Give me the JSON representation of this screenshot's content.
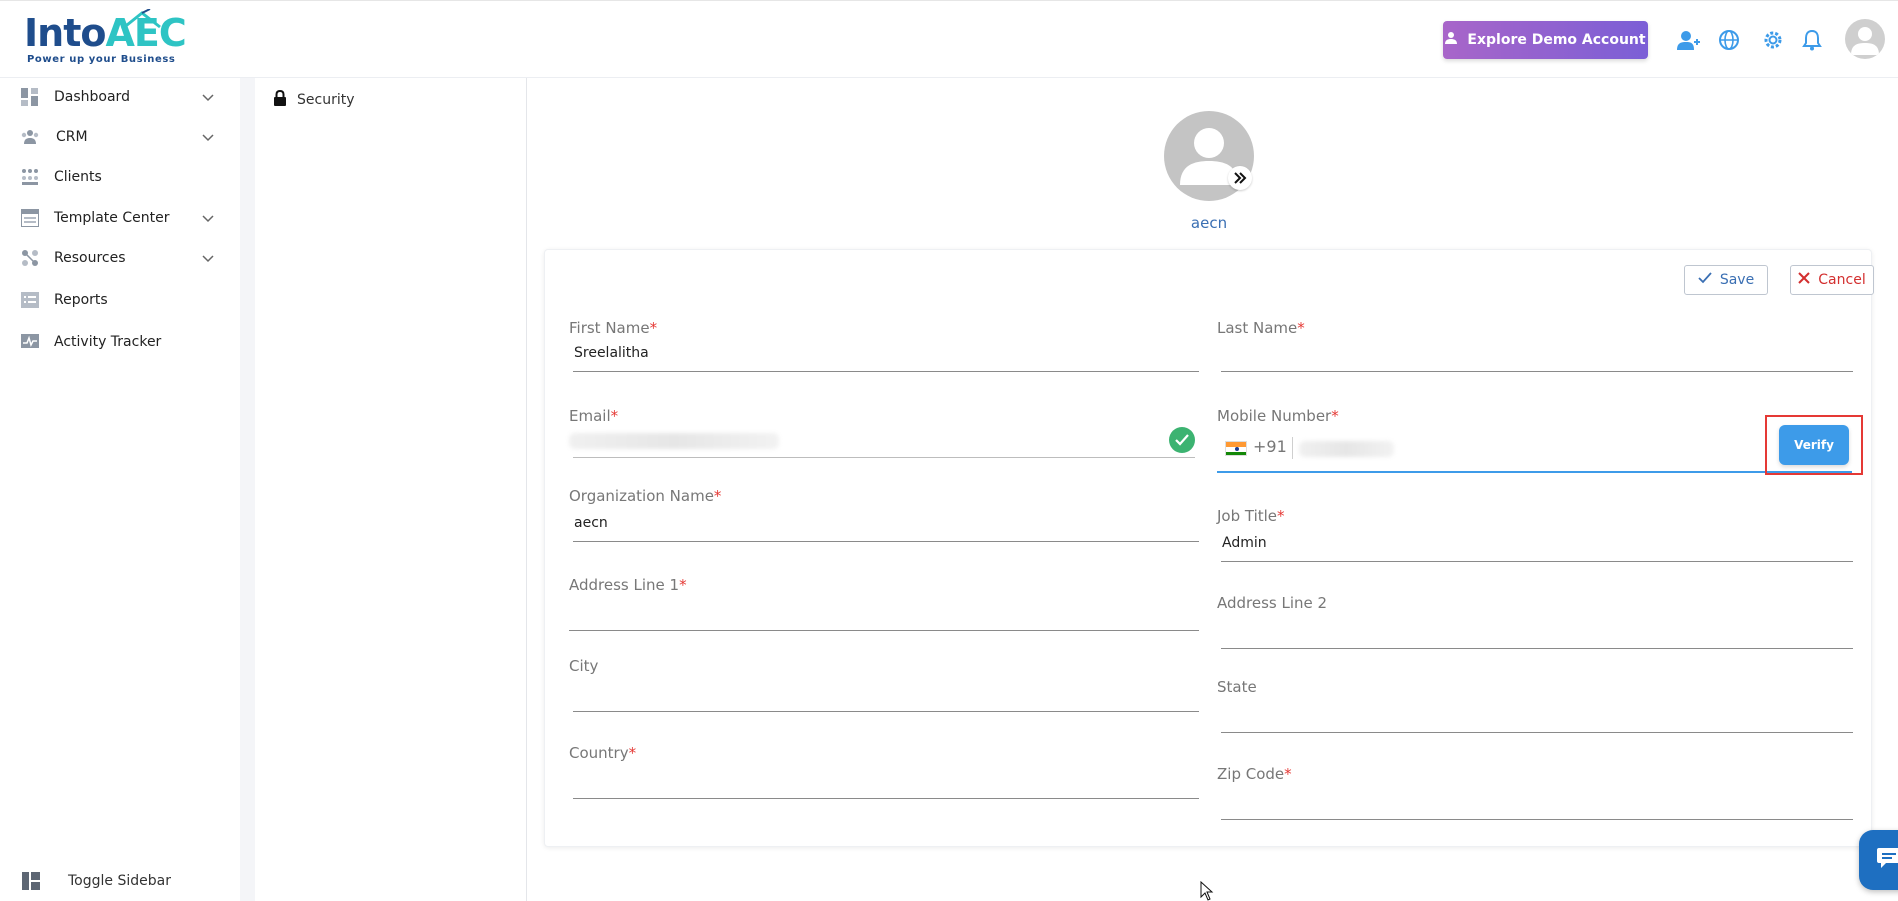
{
  "brand": {
    "logo_primary": "Into",
    "logo_accent": "AEC",
    "tagline": "Power up your Business",
    "color_primary": "#1f4d8c",
    "color_accent": "#2ec4c4"
  },
  "header": {
    "demo_button_label": "Explore Demo Account",
    "icons": [
      "add-user-icon",
      "globe-icon",
      "gear-icon",
      "bell-icon",
      "user-avatar-icon"
    ]
  },
  "sidebar": {
    "items": [
      {
        "label": "Dashboard",
        "icon": "dashboard-icon",
        "has_submenu": true
      },
      {
        "label": "CRM",
        "icon": "crm-icon",
        "has_submenu": true
      },
      {
        "label": "Clients",
        "icon": "clients-icon",
        "has_submenu": false
      },
      {
        "label": "Template Center",
        "icon": "template-icon",
        "has_submenu": true
      },
      {
        "label": "Resources",
        "icon": "resources-icon",
        "has_submenu": true
      },
      {
        "label": "Reports",
        "icon": "reports-icon",
        "has_submenu": false
      },
      {
        "label": "Activity Tracker",
        "icon": "activity-icon",
        "has_submenu": false
      }
    ],
    "toggle_label": "Toggle Sidebar"
  },
  "subpanel": {
    "security_label": "Security"
  },
  "profile": {
    "name": "aecn"
  },
  "form": {
    "save_label": "Save",
    "cancel_label": "Cancel",
    "required_mark": "*",
    "first_name": {
      "label": "First Name",
      "value": "Sreelalitha"
    },
    "last_name": {
      "label": "Last Name",
      "value": ""
    },
    "email": {
      "label": "Email",
      "value": ""
    },
    "mobile": {
      "label": "Mobile Number",
      "dial_code": "+91",
      "verify_label": "Verify"
    },
    "organization": {
      "label": "Organization Name",
      "value": "aecn"
    },
    "job_title": {
      "label": "Job Title",
      "value": "Admin"
    },
    "address1": {
      "label": "Address Line 1",
      "value": ""
    },
    "address2": {
      "label": "Address Line 2",
      "value": ""
    },
    "city": {
      "label": "City",
      "value": ""
    },
    "state": {
      "label": "State",
      "value": ""
    },
    "country": {
      "label": "Country",
      "value": ""
    },
    "zip": {
      "label": "Zip Code",
      "value": ""
    }
  },
  "colors": {
    "link_blue": "#3a6fb3",
    "verify_blue": "#3d9be9",
    "required_red": "#e53935",
    "success_green": "#3cb371",
    "chat_blue": "#1e6fc1"
  }
}
